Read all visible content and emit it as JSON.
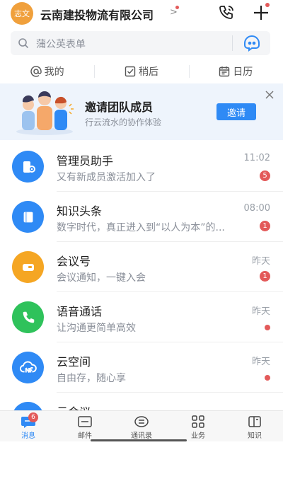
{
  "header": {
    "avatar_text": "志文",
    "org_name": "云南建投物流有限公司",
    "org_chevron": ">",
    "call_icon": "phone-icon",
    "plus_icon": "plus-icon"
  },
  "search": {
    "placeholder": "蒲公英表单",
    "icon": "search-icon",
    "assistant_icon": "robot-icon"
  },
  "filters": [
    {
      "label": "我的",
      "icon": "at-icon"
    },
    {
      "label": "稍后",
      "icon": "check-square-icon"
    },
    {
      "label": "日历",
      "icon": "calendar-icon"
    }
  ],
  "banner": {
    "title": "邀请团队成员",
    "subtitle": "行云流水的协作体验",
    "button": "邀请",
    "close_icon": "close-icon"
  },
  "chats": [
    {
      "title": "管理员助手",
      "preview": "又有新成员激活加入了",
      "time": "11:02",
      "badge": "5",
      "color": "#2f8af5",
      "icon": "admin-assistant-icon"
    },
    {
      "title": "知识头条",
      "preview": "数字时代，真正进入到“以人为本”的...",
      "time": "08:00",
      "badge": "1",
      "color": "#2f8af5",
      "icon": "book-icon"
    },
    {
      "title": "会议号",
      "preview": "会议通知，一键入会",
      "time": "昨天",
      "badge": "1",
      "color": "#f5a623",
      "icon": "video-camera-icon"
    },
    {
      "title": "语音通话",
      "preview": "让沟通更简单高效",
      "time": "昨天",
      "badge": "",
      "color": "#2fc25b",
      "icon": "phone-icon"
    },
    {
      "title": "云空间",
      "preview": "自由存，随心享",
      "time": "昨天",
      "badge": "",
      "color": "#2f8af5",
      "icon": "cloud-drive-icon"
    },
    {
      "title": "云会议",
      "preview": "",
      "time": "",
      "badge": "",
      "color": "#2f8af5",
      "icon": "chat-icon"
    }
  ],
  "nav": [
    {
      "label": "消息",
      "icon": "message-icon",
      "badge": "6",
      "active": true
    },
    {
      "label": "邮件",
      "icon": "mail-icon",
      "badge": "",
      "active": false
    },
    {
      "label": "通讯录",
      "icon": "contacts-icon",
      "badge": "",
      "active": false
    },
    {
      "label": "业务",
      "icon": "apps-grid-icon",
      "badge": "",
      "active": false
    },
    {
      "label": "知识",
      "icon": "knowledge-icon",
      "badge": "",
      "active": false
    }
  ],
  "colors": {
    "accent": "#2f8af5",
    "badge": "#e35a5a",
    "avatar": "#f0a03c"
  }
}
